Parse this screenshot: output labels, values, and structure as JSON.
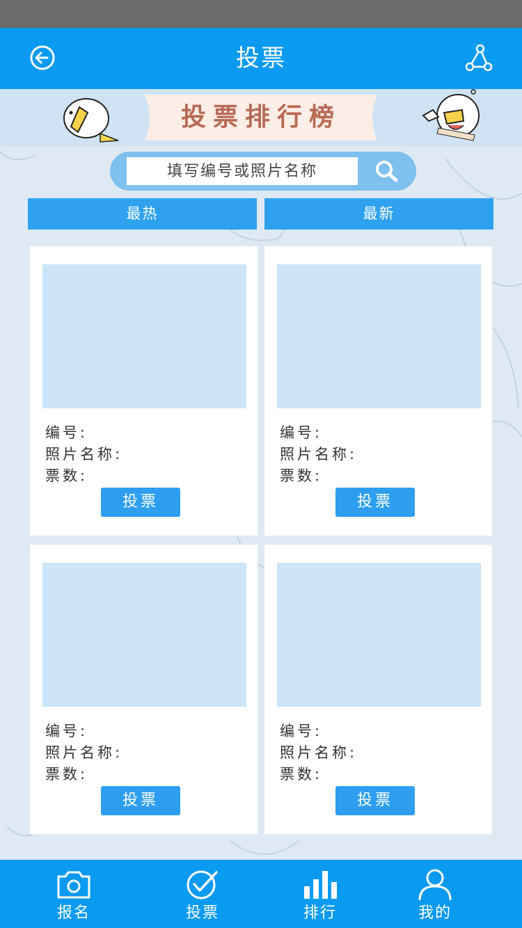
{
  "header": {
    "title": "投票",
    "back_icon": "back-arrow-circle-icon",
    "share_icon": "share-icon"
  },
  "banner": {
    "title": "投票排行榜"
  },
  "search": {
    "placeholder": "填写编号或照片名称",
    "icon": "search-icon"
  },
  "tabs": [
    {
      "label": "最热"
    },
    {
      "label": "最新"
    }
  ],
  "cards": [
    {
      "id_label": "编号:",
      "name_label": "照片名称:",
      "votes_label": "票数:",
      "button": "投票"
    },
    {
      "id_label": "编号:",
      "name_label": "照片名称:",
      "votes_label": "票数:",
      "button": "投票"
    },
    {
      "id_label": "编号:",
      "name_label": "照片名称:",
      "votes_label": "票数:",
      "button": "投票"
    },
    {
      "id_label": "编号:",
      "name_label": "照片名称:",
      "votes_label": "票数:",
      "button": "投票"
    }
  ],
  "tabbar": [
    {
      "label": "报名",
      "icon": "camera-icon"
    },
    {
      "label": "投票",
      "icon": "check-circle-icon"
    },
    {
      "label": "排行",
      "icon": "bar-chart-icon"
    },
    {
      "label": "我的",
      "icon": "user-icon"
    }
  ],
  "colors": {
    "primary": "#0a9af0",
    "tab": "#2ea2ee",
    "photo_placeholder": "#cce5f8",
    "background": "#dfe9f3"
  }
}
